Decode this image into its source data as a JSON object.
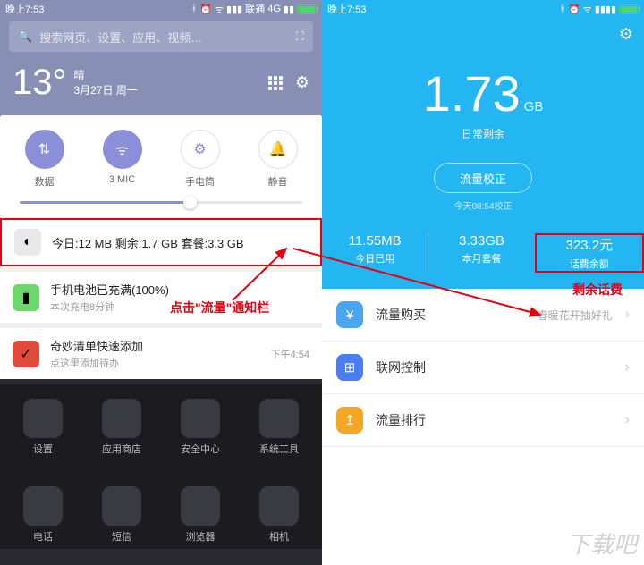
{
  "status": {
    "time": "晚上7:53",
    "carrier": "联通",
    "net": "4G"
  },
  "left": {
    "search_placeholder": "搜索网页、设置、应用、视频…",
    "weather": {
      "temp": "13°",
      "cond": "晴",
      "date": "3月27日",
      "dow": "周一"
    },
    "toggles": [
      {
        "label": "数据",
        "active": true,
        "icon": "⇅"
      },
      {
        "label": "3  MIC",
        "active": true,
        "icon": "ᯤ"
      },
      {
        "label": "手电筒",
        "active": false,
        "icon": "⚙"
      },
      {
        "label": "静音",
        "active": false,
        "icon": "🔔"
      }
    ],
    "notifications": [
      {
        "id": "data",
        "title": "今日:12 MB  剩余:1.7 GB  套餐:3.3 GB",
        "sub": "",
        "time": "",
        "icon_bg": "#e8e8ea",
        "icon": "◐"
      },
      {
        "id": "battery",
        "title": "手机电池已充满(100%)",
        "sub": "本次充电8分钟",
        "time": "",
        "icon_bg": "#6bd86b",
        "icon": "▮"
      },
      {
        "id": "wunder",
        "title": "奇妙清单快速添加",
        "sub": "点这里添加待办",
        "time": "下午4:54",
        "icon_bg": "#e14a3a",
        "icon": "✓"
      }
    ],
    "approw1": [
      {
        "label": "设置"
      },
      {
        "label": "应用商店"
      },
      {
        "label": "安全中心"
      },
      {
        "label": "系统工具"
      }
    ],
    "approw2": [
      {
        "label": "电话"
      },
      {
        "label": "短信"
      },
      {
        "label": "浏览器"
      },
      {
        "label": "相机"
      }
    ]
  },
  "right": {
    "big_value": "1.73",
    "big_unit": "GB",
    "big_sub": "日常剩余",
    "calibrate_btn": "流量校正",
    "calibrate_time": "今天08:54校正",
    "stats": [
      {
        "v": "11.55MB",
        "l": "今日已用"
      },
      {
        "v": "3.33GB",
        "l": "本月套餐"
      },
      {
        "v": "323.2元",
        "l": "话费余额"
      }
    ],
    "list": [
      {
        "label": "流量购买",
        "extra": "春暖花开抽好礼",
        "color": "#4aa6f0",
        "icon": "¥"
      },
      {
        "label": "联网控制",
        "extra": "",
        "color": "#4a7ef0",
        "icon": "⊞"
      },
      {
        "label": "流量排行",
        "extra": "",
        "color": "#f5a623",
        "icon": "↥"
      }
    ]
  },
  "annotations": {
    "click_data": "点击\"流量\"通知栏",
    "balance": "剩余话费"
  },
  "watermark": "下载吧"
}
